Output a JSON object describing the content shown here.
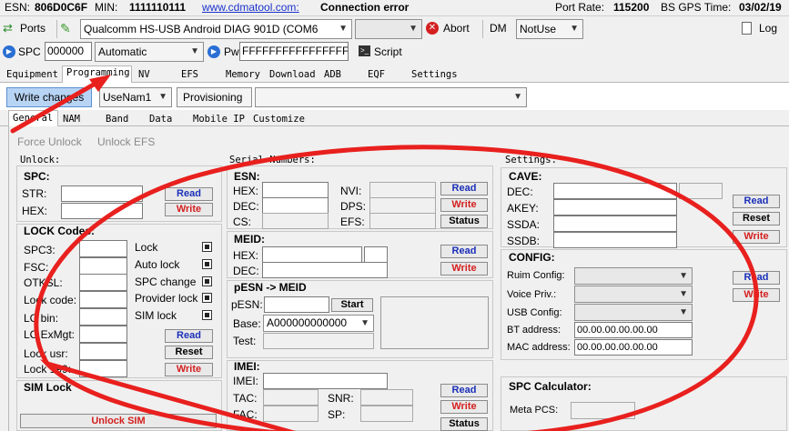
{
  "status": {
    "esn_label": "ESN:",
    "esn_value": "806D0C6F",
    "min_label": "MIN:",
    "min_value": "1111110111",
    "site": "www.cdmatool.com:",
    "conn": "Connection error",
    "rate_label": "Port Rate:",
    "rate_value": "115200",
    "gps_label": "BS GPS Time:",
    "gps_value": "03/02/19"
  },
  "toolbar": {
    "ports": "Ports",
    "port_value": "Qualcomm HS-USB Android DIAG 901D (COM6",
    "abort": "Abort",
    "dm": "DM",
    "dm_value": "NotUse",
    "log": "Log",
    "spc": "SPC",
    "spc_value": "000000",
    "spc_mode": "Automatic",
    "pwd": "Pwd",
    "pwd_value": "FFFFFFFFFFFFFFFF",
    "script": "Script"
  },
  "tabs": [
    "Equipment",
    "Programming",
    "NV",
    "EFS",
    "Memory",
    "Download",
    "ADB",
    "EQF",
    "Settings"
  ],
  "prog": {
    "write_changes": "Write changes",
    "usenam": "UseNam1",
    "provisioning": "Provisioning"
  },
  "subtabs": [
    "General",
    "NAM",
    "Band",
    "Data",
    "Mobile IP",
    "Customize"
  ],
  "general": {
    "force_unlock": "Force Unlock",
    "unlock_efs": "Unlock EFS",
    "unlock": "Unlock:",
    "serial": "Serial Numbers:",
    "settings": "Settings:",
    "read": "Read",
    "write": "Write",
    "status": "Status",
    "reset": "Reset",
    "start": "Start"
  },
  "spc": {
    "title": "SPC:",
    "str": "STR:",
    "hex": "HEX:"
  },
  "lock": {
    "title": "LOCK Codes:",
    "codes": [
      "SPC3:",
      "FSC:",
      "OTKSL:",
      "Lock code:",
      "LC bin:",
      "LC ExMgt:",
      "Lock usr:",
      "Lock 199:"
    ],
    "checks": [
      "Lock",
      "Auto lock",
      "SPC change",
      "Provider lock",
      "SIM lock"
    ]
  },
  "sim": {
    "title": "SIM Lock",
    "unlock": "Unlock SIM"
  },
  "esn": {
    "title": "ESN:",
    "hex": "HEX:",
    "dec": "DEC:",
    "cs": "CS:",
    "nvi": "NVI:",
    "dps": "DPS:",
    "efs": "EFS:"
  },
  "meid": {
    "title": "MEID:",
    "hex": "HEX:",
    "dec": "DEC:"
  },
  "pesn": {
    "title": "pESN -> MEID",
    "pesn": "pESN:",
    "base": "Base:",
    "base_value": "A000000000000",
    "test": "Test:"
  },
  "imei": {
    "title": "IMEI:",
    "imei": "IMEI:",
    "tac": "TAC:",
    "fac": "FAC:",
    "snr": "SNR:",
    "sp": "SP:"
  },
  "cave": {
    "title": "CAVE:",
    "dec": "DEC:",
    "akey": "AKEY:",
    "ssda": "SSDA:",
    "ssdb": "SSDB:"
  },
  "config": {
    "title": "CONFIG:",
    "ruim": "Ruim Config:",
    "voice": "Voice Priv.:",
    "usb": "USB Config:",
    "bt": "BT address:",
    "bt_value": "00.00.00.00.00.00",
    "mac": "MAC address:",
    "mac_value": "00.00.00.00.00.00"
  },
  "spccalc": {
    "title": "SPC Calculator:",
    "meta": "Meta PCS:"
  },
  "colors": {
    "annotation": "#e8201e",
    "read": "#1a2fb8",
    "write": "#d42020"
  }
}
